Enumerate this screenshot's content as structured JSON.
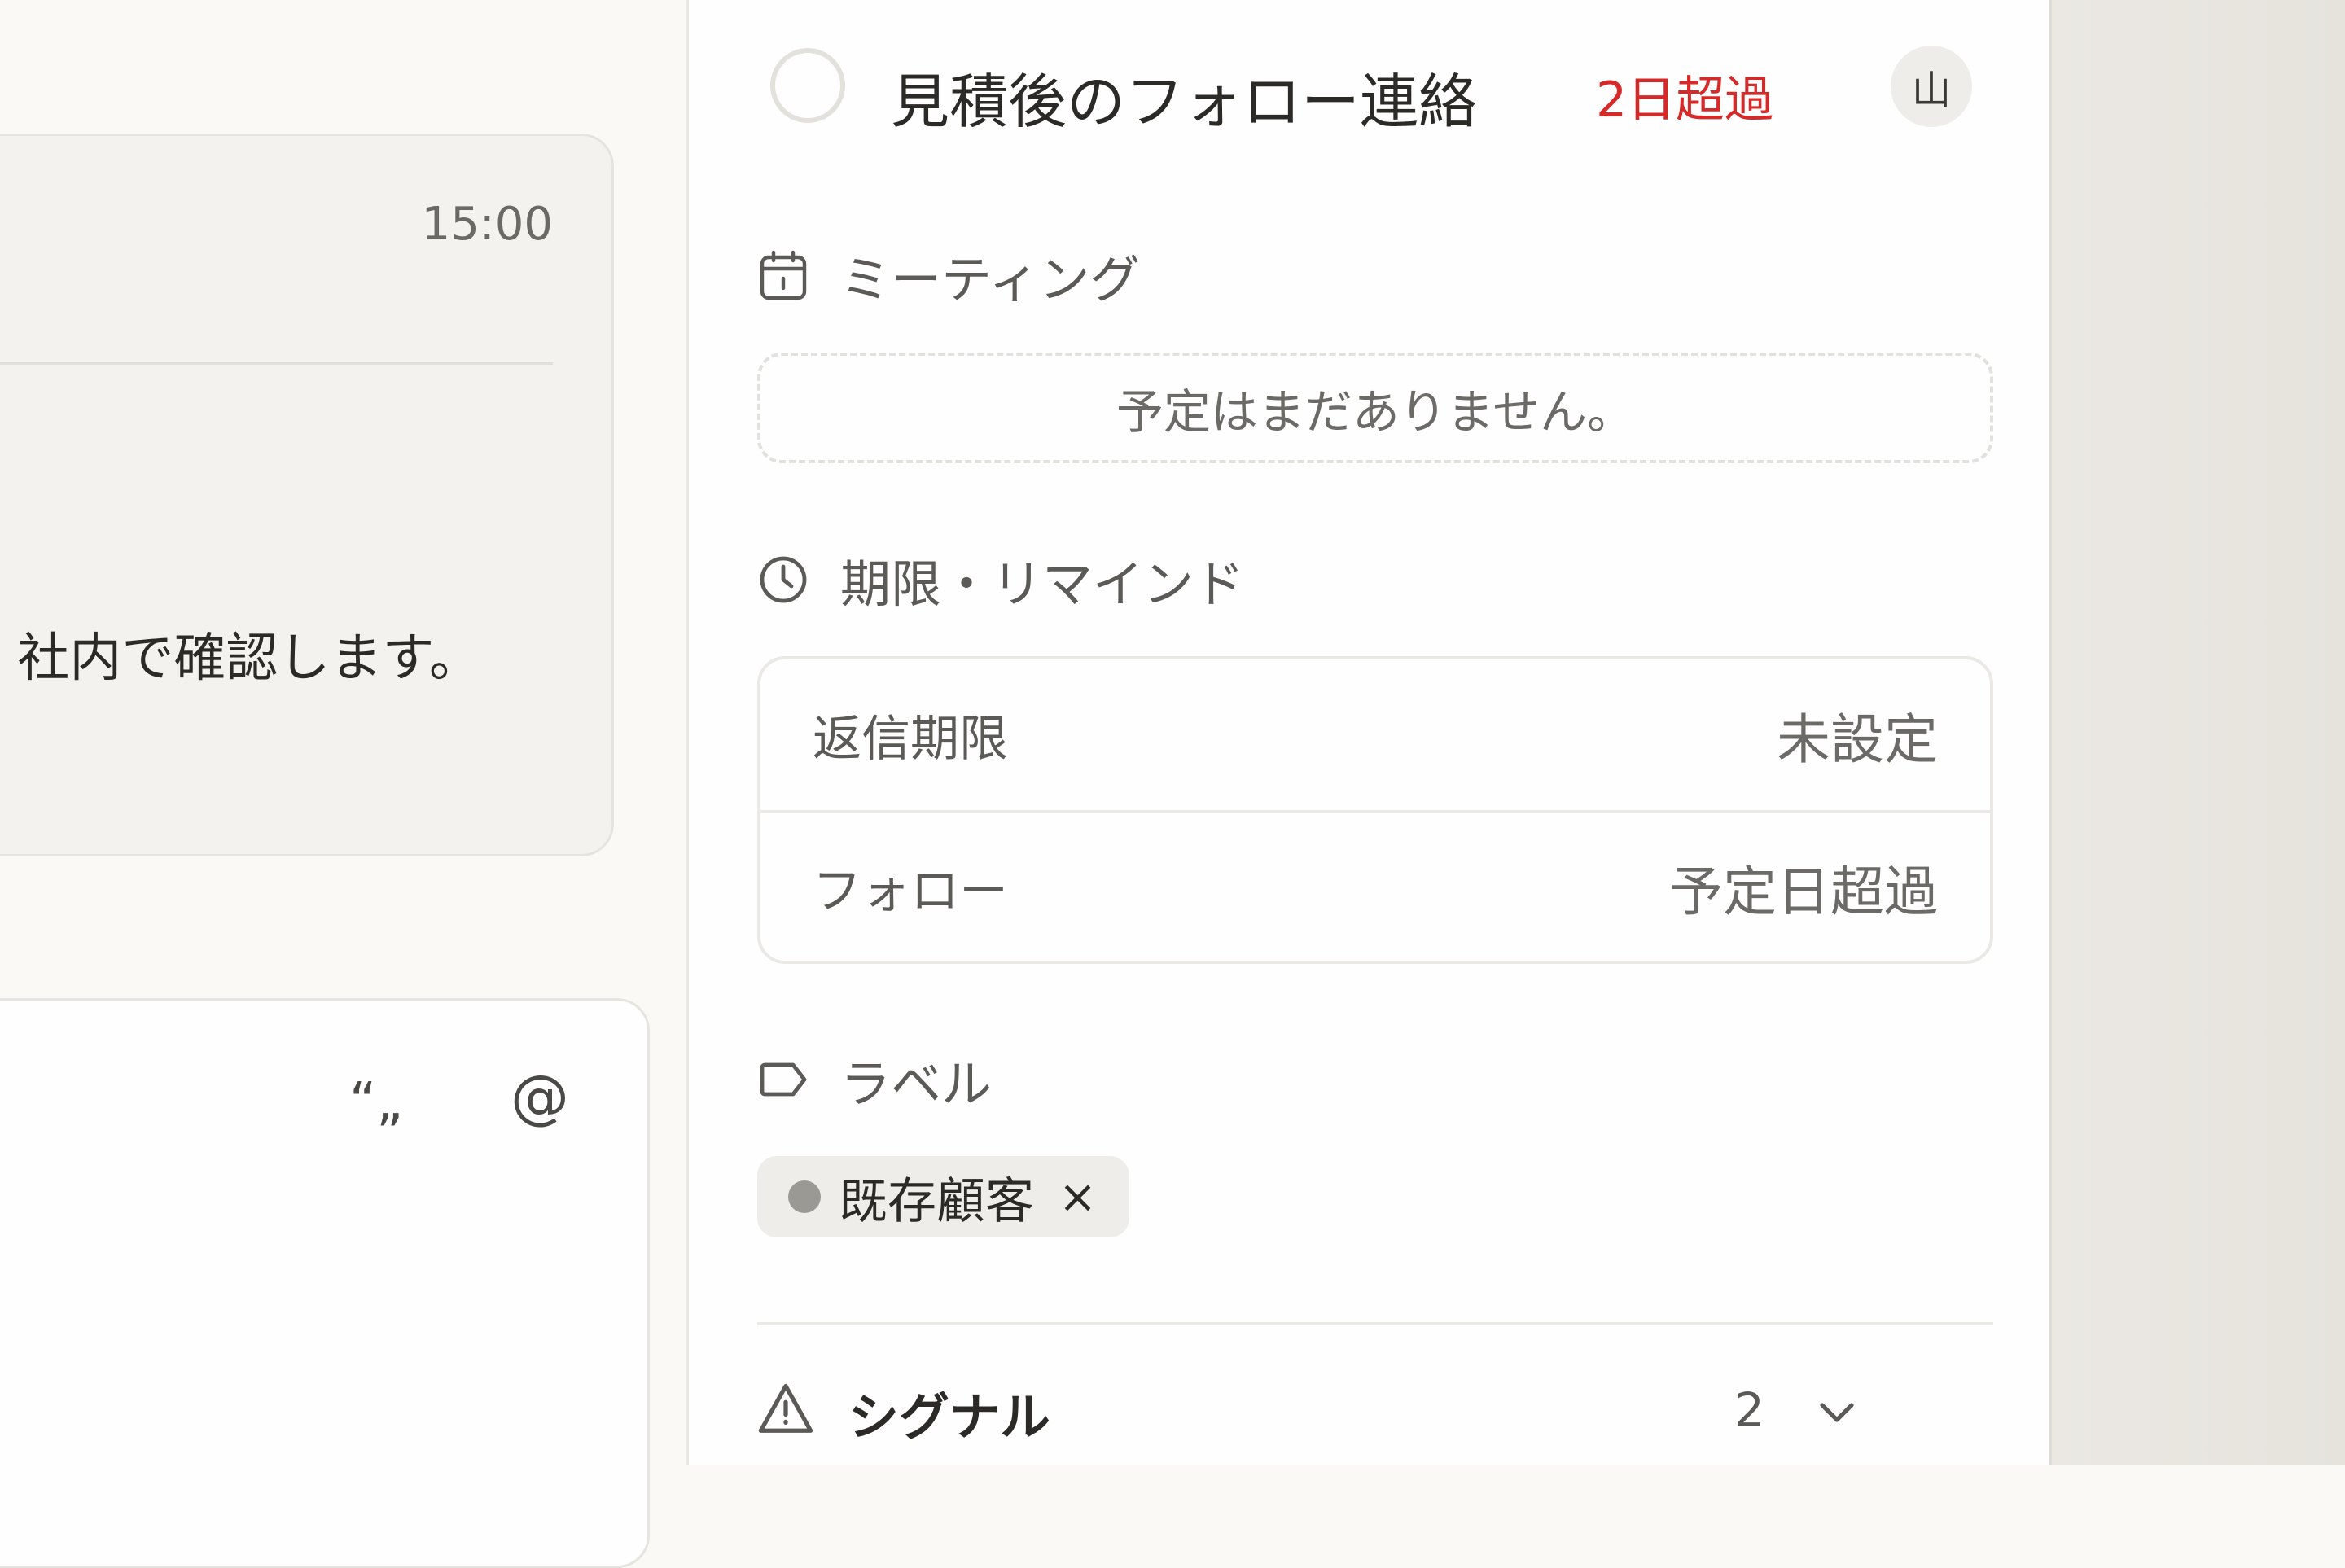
{
  "left": {
    "message": {
      "time": "15:00",
      "text": "社内で確認します。"
    },
    "composer": {
      "quote_icon": "“„",
      "at_icon": "@"
    }
  },
  "task": {
    "title": "見積後のフォロー連絡",
    "overdue": "2日超過",
    "assignee_initial": "山"
  },
  "meeting": {
    "heading": "ミーティング",
    "empty_text": "予定はまだありません。"
  },
  "deadline": {
    "heading": "期限・リマインド",
    "rows": [
      {
        "label": "返信期限",
        "value": "未設定"
      },
      {
        "label": "フォロー",
        "value": "予定日超過"
      }
    ]
  },
  "labels": {
    "heading": "ラベル",
    "tags": [
      {
        "label": "既存顧客",
        "remove": "×",
        "color": "#9a9994"
      }
    ]
  },
  "signals": {
    "heading": "シグナル",
    "count": "2"
  },
  "colors": {
    "overdue": "#d52a2a",
    "panel_bg": "#fefefe",
    "page_bg": "#faf9f6"
  },
  "icons": {
    "meeting": "calendar-icon",
    "deadline": "clock-icon",
    "labels": "tag-icon",
    "signals": "warning-icon",
    "expand": "chevron-down-icon"
  }
}
